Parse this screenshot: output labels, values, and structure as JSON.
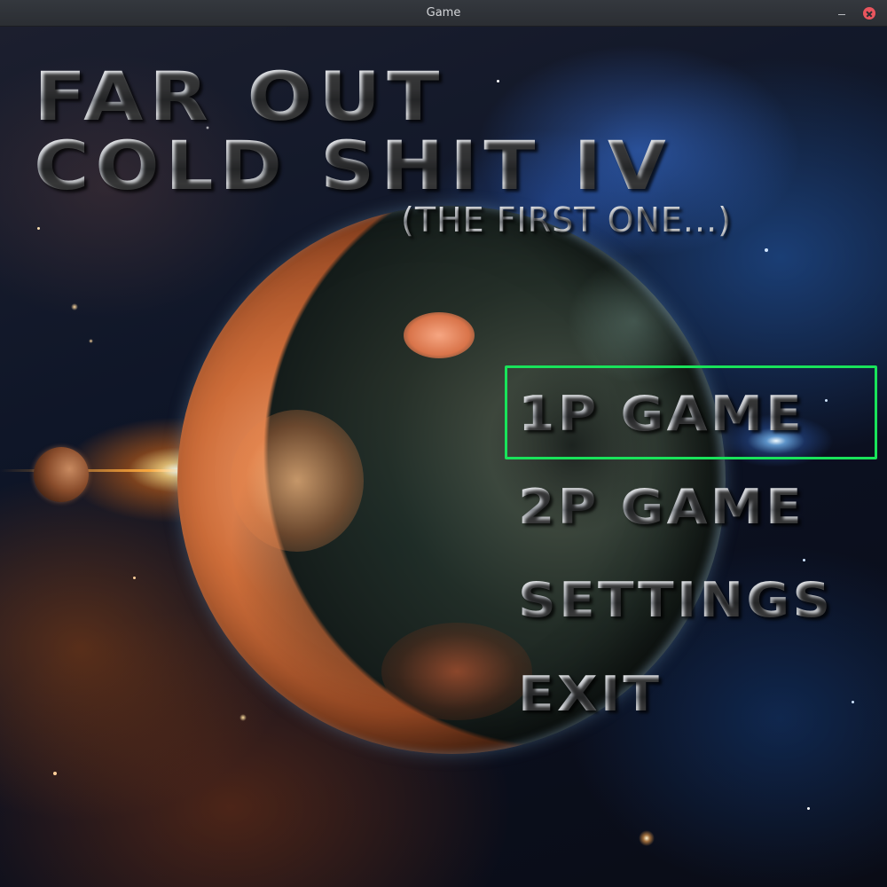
{
  "window": {
    "title": "Game"
  },
  "game": {
    "title_line1": "FAR OUT",
    "title_line2": "COLD SHIT IV",
    "subtitle": "(THE FIRST ONE...)"
  },
  "menu": {
    "items": [
      {
        "label": "1P GAME",
        "selected": true
      },
      {
        "label": "2P GAME",
        "selected": false
      },
      {
        "label": "SETTINGS",
        "selected": false
      },
      {
        "label": "EXIT",
        "selected": false
      }
    ]
  },
  "colors": {
    "selection_highlight": "#19e35a",
    "close_button": "#e9555e"
  },
  "icons": {
    "minimize": "minimize-icon",
    "close": "close-icon"
  }
}
